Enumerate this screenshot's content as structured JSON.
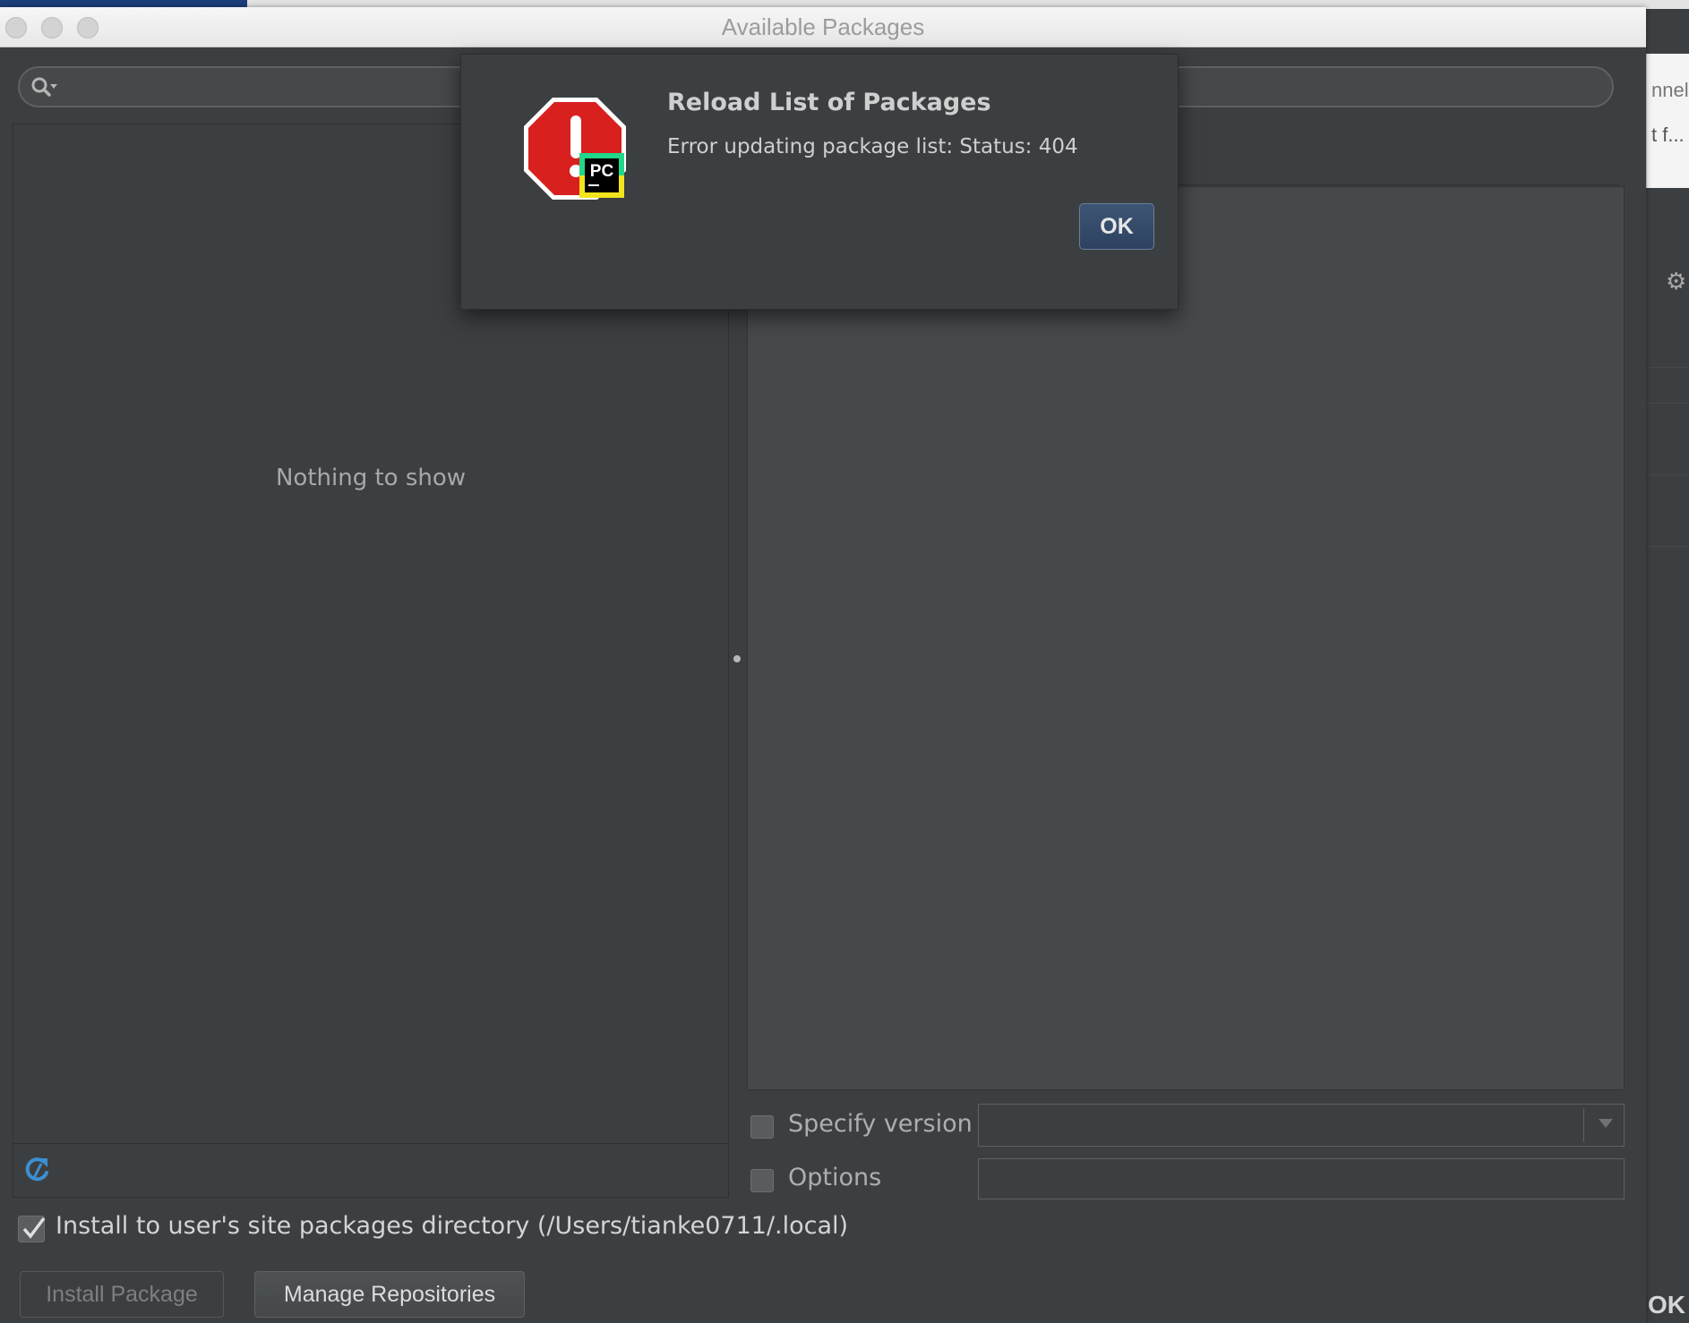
{
  "window": {
    "title": "Available Packages"
  },
  "search": {
    "placeholder": "",
    "icon": "search-icon"
  },
  "package_list": {
    "empty_text": "Nothing to show",
    "refresh_icon": "refresh-icon"
  },
  "options": {
    "specify_version_label": "Specify version",
    "specify_version_checked": false,
    "options_label": "Options",
    "options_checked": false
  },
  "install_user_site": {
    "label": "Install to user's site packages directory (/Users/tianke0711/.local)",
    "checked": true
  },
  "buttons": {
    "install_package": "Install Package",
    "manage_repositories": "Manage Repositories"
  },
  "dialog": {
    "title": "Reload List of Packages",
    "message": "Error updating package list: Status: 404",
    "ok_label": "OK",
    "icon": "error-stop-icon",
    "badge": "PC"
  },
  "background_app": {
    "text_fragment_1": "nnel",
    "text_fragment_2": "t f...",
    "ok_fragment": "OK"
  },
  "colors": {
    "panel_bg": "#3c3f41",
    "error_red": "#d8201f",
    "ok_button": "#2d4260"
  }
}
